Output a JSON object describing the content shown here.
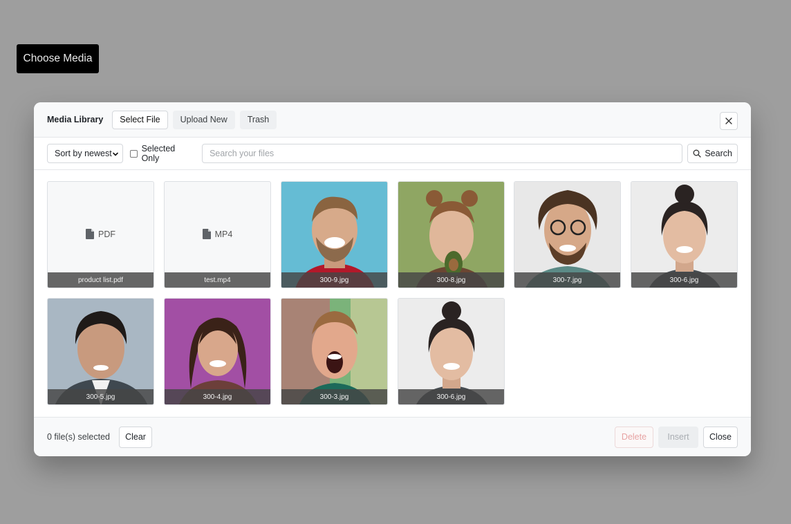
{
  "page": {
    "choose_media_label": "Choose Media"
  },
  "modal": {
    "title": "Media Library",
    "tabs": [
      {
        "label": "Select File",
        "active": true
      },
      {
        "label": "Upload New",
        "active": false
      },
      {
        "label": "Trash",
        "active": false
      }
    ],
    "close_icon": "close-icon"
  },
  "toolbar": {
    "sort_value": "Sort by newest",
    "selected_only_label": "Selected Only",
    "selected_only_checked": false,
    "search_placeholder": "Search your files",
    "search_value": "",
    "search_label": "Search"
  },
  "files": [
    {
      "name": "product list.pdf",
      "kind": "file",
      "type_label": "PDF"
    },
    {
      "name": "test.mp4",
      "kind": "file",
      "type_label": "MP4"
    },
    {
      "name": "300-9.jpg",
      "kind": "image"
    },
    {
      "name": "300-8.jpg",
      "kind": "image"
    },
    {
      "name": "300-7.jpg",
      "kind": "image"
    },
    {
      "name": "300-6.jpg",
      "kind": "image"
    },
    {
      "name": "300-5.jpg",
      "kind": "image"
    },
    {
      "name": "300-4.jpg",
      "kind": "image"
    },
    {
      "name": "300-3.jpg",
      "kind": "image"
    },
    {
      "name": "300-6.jpg",
      "kind": "image"
    }
  ],
  "footer": {
    "selected_count_text": "0 file(s) selected",
    "clear_label": "Clear",
    "delete_label": "Delete",
    "insert_label": "Insert",
    "close_label": "Close"
  },
  "colors": {
    "backdrop": "#9e9e9e",
    "delete_text": "#e7a3a3"
  }
}
